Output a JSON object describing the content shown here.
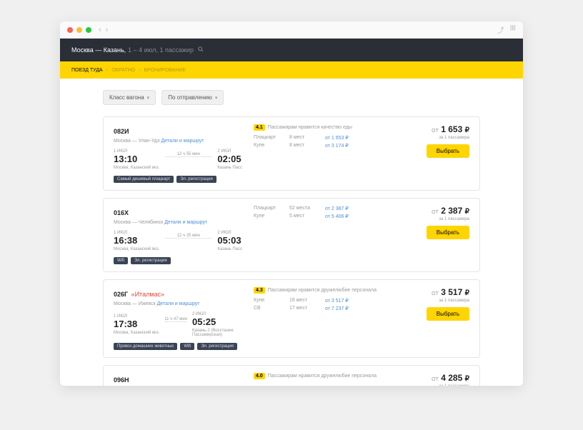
{
  "header": {
    "route": "Москва — Казань,",
    "details": "1 – 4 июл, 1 пассажир"
  },
  "crumbs": {
    "active": "ПОЕЗД ТУДА",
    "c2": "ОБРАТНО",
    "c3": "БРОНИРОВАНИЕ"
  },
  "filters": {
    "class": "Класс вагона",
    "sort": "По отправлению"
  },
  "labels": {
    "ot": "ОТ",
    "per": "за 1 пассажира",
    "select": "Выбрать",
    "details_link": "Детали и маршрут"
  },
  "trains": [
    {
      "num": "082И",
      "name": "",
      "route": "Москва — Улан-Удэ",
      "dep_date": "1 ИЮЛ",
      "dep_time": "13:10",
      "dep_st": "Москва, Казанский вкз.",
      "arr_date": "2 ИЮЛ",
      "arr_time": "02:05",
      "arr_st": "Казань Пасс",
      "duration": "12 ч 55 мин",
      "rating": "4.1",
      "rating_txt": "Пассажирам нравится качество еды",
      "classes": [
        {
          "name": "Плацкарт",
          "seats": "8 мест",
          "price": "от 1 653 ₽"
        },
        {
          "name": "Купе",
          "seats": "8 мест",
          "price": "от 3 174 ₽"
        }
      ],
      "price": "1 653",
      "tags": [
        "Самый дешевый плацкарт",
        "Эл. регистрация"
      ]
    },
    {
      "num": "016Х",
      "name": "",
      "route": "Москва — Челябинск",
      "dep_date": "1 ИЮЛ",
      "dep_time": "16:38",
      "dep_st": "Москва, Казанский вкз.",
      "arr_date": "2 ИЮЛ",
      "arr_time": "05:03",
      "arr_st": "Казань Пасс",
      "duration": "12 ч 25 мин",
      "rating": "",
      "rating_txt": "",
      "classes": [
        {
          "name": "Плацкарт",
          "seats": "52 места",
          "price": "от 2 387 ₽"
        },
        {
          "name": "Купе",
          "seats": "5 мест",
          "price": "от 5 406 ₽"
        }
      ],
      "price": "2 387",
      "tags": [
        "Wifi",
        "Эл. регистрация"
      ]
    },
    {
      "num": "026Г",
      "name": "«Италмас»",
      "route": "Москва — Ижевск",
      "dep_date": "1 ИЮЛ",
      "dep_time": "17:38",
      "dep_st": "Москва, Казанский вкз.",
      "arr_date": "2 ИЮЛ",
      "arr_time": "05:25",
      "arr_st": "Казань-2 (Восстание Пассажирская)",
      "duration": "11 ч 47 мин",
      "rating": "4.3",
      "rating_txt": "Пассажирам нравится дружелюбие персонала",
      "classes": [
        {
          "name": "Купе",
          "seats": "16 мест",
          "price": "от 3 517 ₽"
        },
        {
          "name": "СВ",
          "seats": "17 мест",
          "price": "от 7 237 ₽"
        }
      ],
      "price": "3 517",
      "tags": [
        "Провоз домашних животных",
        "Wifi",
        "Эл. регистрация"
      ]
    },
    {
      "num": "096Н",
      "name": "",
      "route": "",
      "dep_date": "",
      "dep_time": "",
      "dep_st": "",
      "arr_date": "",
      "arr_time": "",
      "arr_st": "",
      "duration": "",
      "rating": "4.0",
      "rating_txt": "Пассажирам нравится дружелюбие персонала",
      "classes": [],
      "price": "4 285",
      "tags": []
    }
  ]
}
